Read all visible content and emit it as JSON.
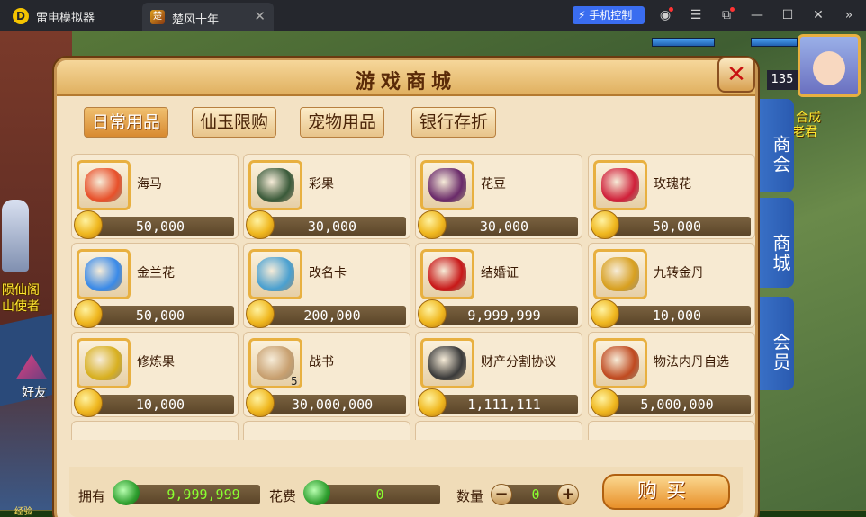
{
  "emulator": {
    "app_title": "雷电模拟器",
    "tab_label": "楚风十年",
    "phone_control": "手机控制"
  },
  "hud": {
    "level": "135",
    "npc_right_1": "合成",
    "npc_right_2": "老君",
    "npc_left_1": "陨仙阁",
    "npc_left_2": "山使者",
    "friend": "好友",
    "exp": "经验"
  },
  "side_tabs": [
    "商会",
    "商城",
    "会员"
  ],
  "shop": {
    "title": "游戏商城",
    "categories": [
      {
        "label": "日常用品",
        "active": true
      },
      {
        "label": "仙玉限购",
        "active": false
      },
      {
        "label": "宠物用品",
        "active": false
      },
      {
        "label": "银行存折",
        "active": false
      }
    ],
    "items": [
      {
        "name": "海马",
        "price": "50,000",
        "icon": "seahorse-icon",
        "color": "#e8502a"
      },
      {
        "name": "彩果",
        "price": "30,000",
        "icon": "fruit-icon",
        "color": "#3a5a3a"
      },
      {
        "name": "花豆",
        "price": "30,000",
        "icon": "bean-icon",
        "color": "#6a2a6a"
      },
      {
        "name": "玫瑰花",
        "price": "50,000",
        "icon": "rose-icon",
        "color": "#d0203a"
      },
      {
        "name": "金兰花",
        "price": "50,000",
        "icon": "blue-flower-icon",
        "color": "#3a8ae8"
      },
      {
        "name": "改名卡",
        "price": "200,000",
        "icon": "rename-card-icon",
        "color": "#4aa0d0"
      },
      {
        "name": "结婚证",
        "price": "9,999,999",
        "icon": "marriage-cert-icon",
        "color": "#c81818"
      },
      {
        "name": "九转金丹",
        "price": "10,000",
        "icon": "golden-pill-icon",
        "color": "#d8a020"
      },
      {
        "name": "修炼果",
        "price": "10,000",
        "icon": "training-fruit-icon",
        "color": "#d8b020"
      },
      {
        "name": "战书",
        "price": "30,000,000",
        "icon": "war-letter-icon",
        "color": "#c8a070",
        "qty": "5"
      },
      {
        "name": "财产分割协议",
        "price": "1,111,111",
        "icon": "sword-icon",
        "color": "#3a3a3a"
      },
      {
        "name": "物法内丹自选",
        "price": "5,000,000",
        "icon": "treasure-chest-icon",
        "color": "#c04a20"
      }
    ],
    "footer": {
      "own_label": "拥有",
      "own_value": "9,999,999",
      "cost_label": "花费",
      "cost_value": "0",
      "qty_label": "数量",
      "qty_value": "0",
      "buy_label": "购买"
    }
  }
}
